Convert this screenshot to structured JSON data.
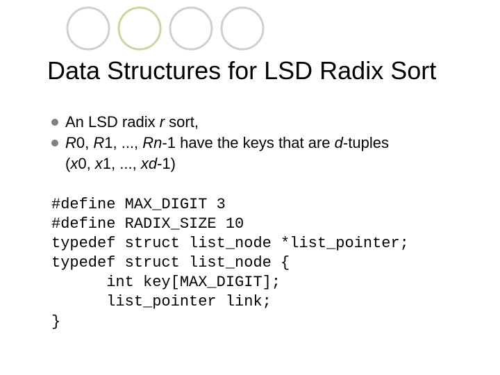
{
  "title": "Data Structures for LSD Radix Sort",
  "bullets": {
    "b1_pre": "An LSD radix ",
    "b1_r": "r",
    "b1_post": " sort,",
    "b2_r0": "R",
    "b2_0": "0, ",
    "b2_r1": "R",
    "b2_1": "1, ..., ",
    "b2_rn": "Rn",
    "b2_mid": "-1 have the keys that are ",
    "b2_d": "d",
    "b2_tuples": "-tuples",
    "b2_line2_open": "(",
    "b2_x0": "x",
    "b2_x0n": "0, ",
    "b2_x1": "x",
    "b2_x1n": "1, ..., ",
    "b2_xd": "xd",
    "b2_close": "-1)"
  },
  "code": {
    "l1": "#define MAX_DIGIT 3",
    "l2": "#define RADIX_SIZE 10",
    "l3": "typedef struct list_node *list_pointer;",
    "l4": "typedef struct list_node {",
    "l5": "      int key[MAX_DIGIT];",
    "l6": "      list_pointer link;",
    "l7": "}"
  }
}
